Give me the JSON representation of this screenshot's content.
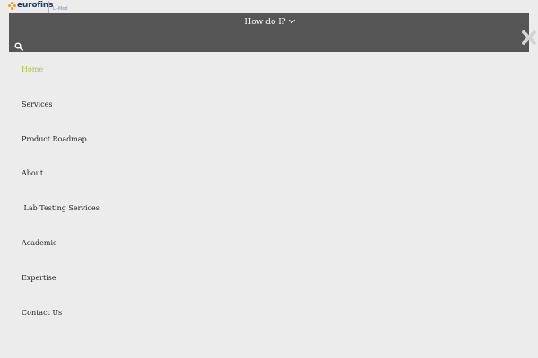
{
  "brand": {
    "name": "eurofins",
    "sub": "Li-Med"
  },
  "header": {
    "dropdown_label": "How do I?"
  },
  "icons": {
    "search": "search-icon",
    "close": "close-icon",
    "chevron": "chevron-down-icon"
  },
  "colors": {
    "band": "#555555",
    "page_bg": "#ececec",
    "active": "#b3c33a",
    "text": "#222222",
    "close": "#d3d3d3"
  },
  "menu": {
    "items": [
      {
        "label": "Home",
        "active": true
      },
      {
        "label": "Services"
      },
      {
        "label": "Product Roadmap"
      },
      {
        "label": "About"
      },
      {
        "label": " Lab Testing Services"
      },
      {
        "label": "Academic"
      },
      {
        "label": "Expertise"
      },
      {
        "label": "Contact Us"
      }
    ]
  }
}
